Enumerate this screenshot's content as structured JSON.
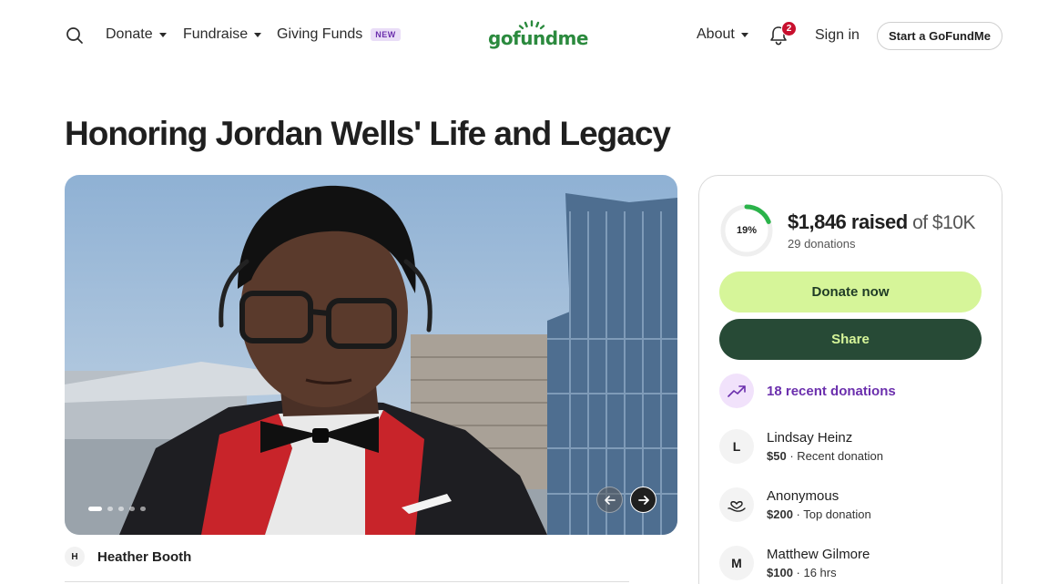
{
  "header": {
    "nav": [
      {
        "label": "Donate",
        "dropdown": true
      },
      {
        "label": "Fundraise",
        "dropdown": true
      },
      {
        "label": "Giving Funds",
        "badge": "NEW"
      }
    ],
    "logo": "gofundme",
    "notifications_count": "2",
    "about_label": "About",
    "sign_in_label": "Sign in",
    "start_label": "Start a GoFundMe"
  },
  "page": {
    "title": "Honoring Jordan Wells' Life and Legacy"
  },
  "carousel": {
    "slide_count": 5,
    "active_index": 0
  },
  "organizer": {
    "initial": "H",
    "name": "Heather Booth"
  },
  "donation": {
    "percent": 19,
    "percent_label": "19%",
    "raised_amount": "$1,846 raised",
    "goal_text": " of $10K",
    "donations_count": "29 donations",
    "donate_label": "Donate now",
    "share_label": "Share",
    "recent_label": "18 recent donations",
    "donors": [
      {
        "initial": "L",
        "name": "Lindsay Heinz",
        "amount": "$50",
        "note": " · Recent donation"
      },
      {
        "initial": "",
        "name": "Anonymous",
        "amount": "$200",
        "note": " · Top donation"
      },
      {
        "initial": "M",
        "name": "Matthew Gilmore",
        "amount": "$100",
        "note": " · 16 hrs"
      }
    ]
  },
  "colors": {
    "brand_green": "#2b8a3e",
    "donate_button": "#d6f599",
    "share_button": "#274a36",
    "accent_purple": "#6b2fad",
    "notification_red": "#c8102e"
  },
  "icons": {
    "search": "search-icon",
    "bell": "bell-icon",
    "trend": "trending-up-icon",
    "hand_heart": "hand-heart-icon",
    "arrow_left": "arrow-left-icon",
    "arrow_right": "arrow-right-icon"
  }
}
